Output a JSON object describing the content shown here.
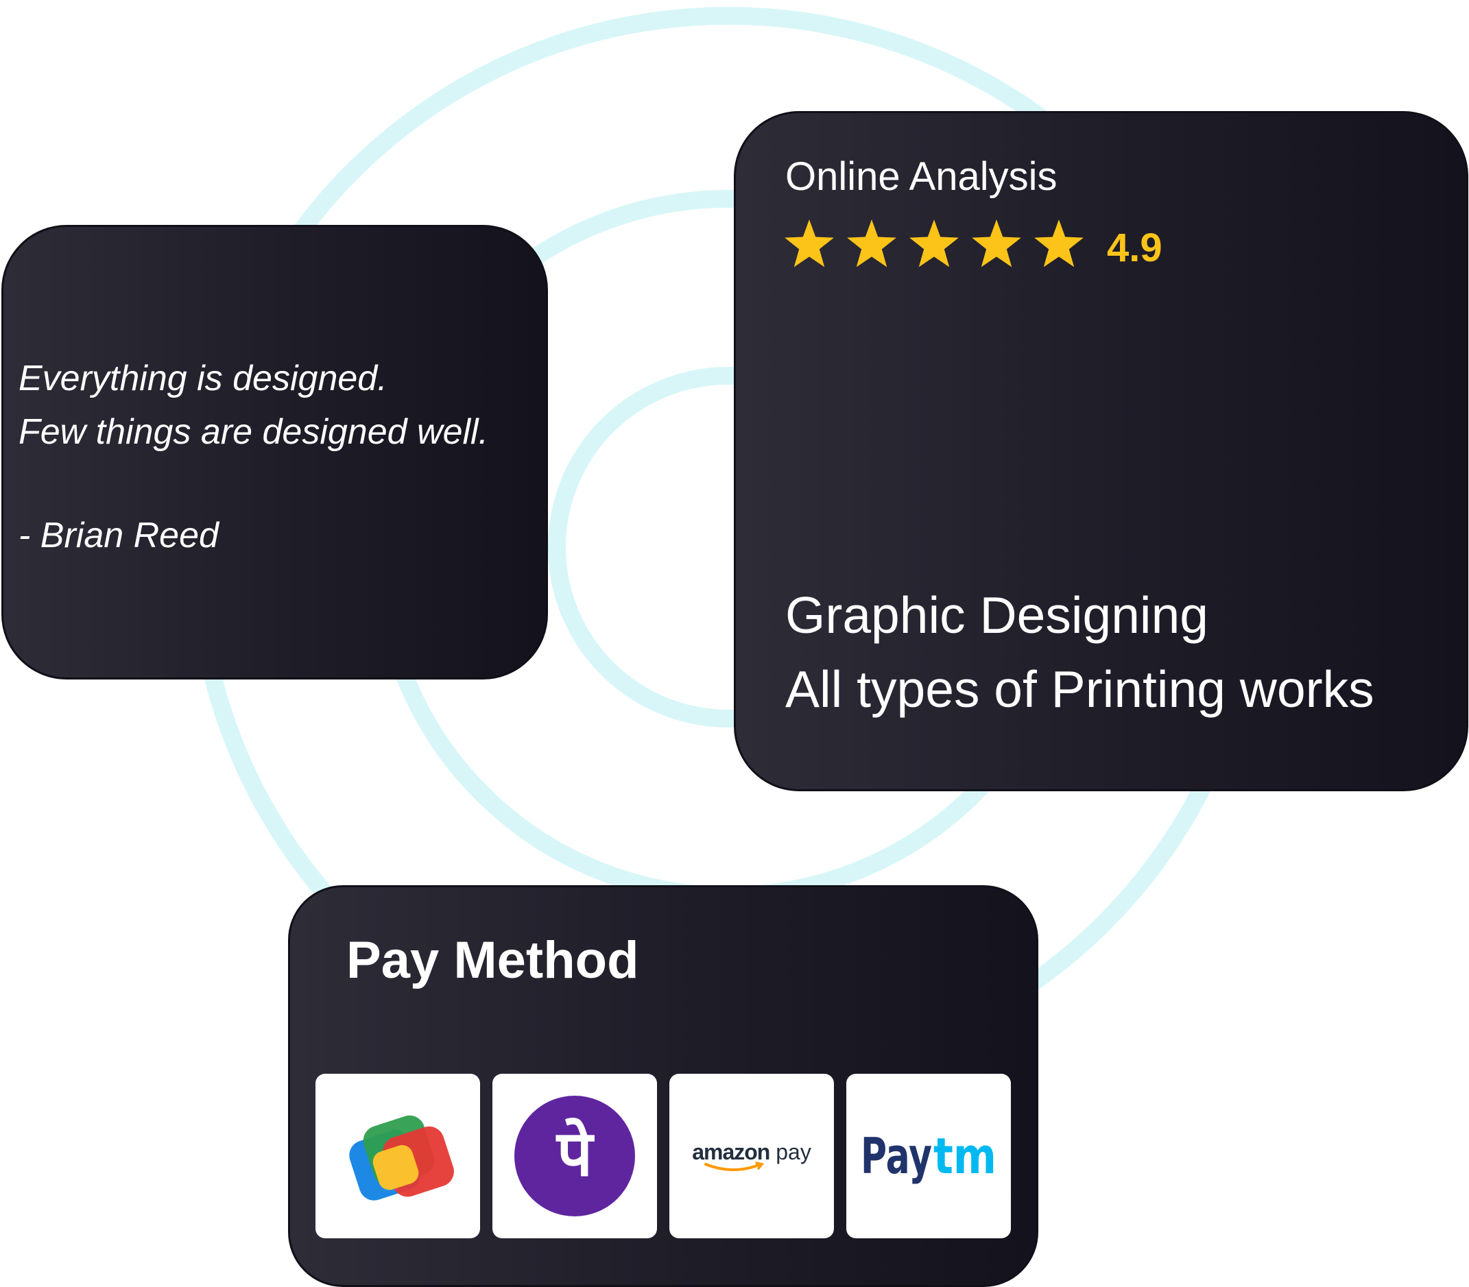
{
  "quote_card": {
    "lines": "Everything is designed.\nFew things are designed well.",
    "author": "- Brian Reed"
  },
  "analysis_card": {
    "title": "Online Analysis",
    "stars_filled": 5,
    "stars_total": 5,
    "rating": "4.9",
    "services": "Graphic Designing\nAll types of Printing works"
  },
  "pay_card": {
    "title": "Pay Method",
    "methods": [
      {
        "icon": "google-pay-icon"
      },
      {
        "icon": "phonepe-icon",
        "logo_text": "पे"
      },
      {
        "icon": "amazon-pay-icon",
        "logo_text_a": "amazon",
        "logo_text_b": " pay"
      },
      {
        "icon": "paytm-icon",
        "logo_text_a": "Pay",
        "logo_text_b": "tm"
      }
    ]
  },
  "colors": {
    "card_dark": "#1e1c27",
    "ring": "#d8f6f8",
    "star": "#fcc419",
    "phonepe_purple": "#5f259f",
    "paytm_navy": "#20336b",
    "paytm_sky": "#00b9f1"
  }
}
